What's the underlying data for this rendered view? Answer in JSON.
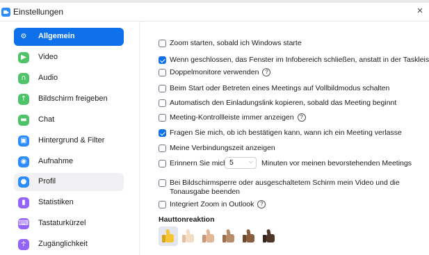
{
  "window": {
    "title": "Einstellungen",
    "close_glyph": "×"
  },
  "sidebar": {
    "items": [
      {
        "label": "Allgemein",
        "icon": "gear-icon",
        "color": "#0e71eb",
        "glyph": "⚙"
      },
      {
        "label": "Video",
        "icon": "video-camera-icon",
        "color": "#4fc36a",
        "glyph": "▶"
      },
      {
        "label": "Audio",
        "icon": "headphones-icon",
        "color": "#4fc36a",
        "glyph": "∩"
      },
      {
        "label": "Bildschirm freigeben",
        "icon": "share-screen-icon",
        "color": "#4fc36a",
        "glyph": "↑"
      },
      {
        "label": "Chat",
        "icon": "chat-bubble-icon",
        "color": "#4fc36a",
        "glyph": "▬"
      },
      {
        "label": "Hintergrund & Filter",
        "icon": "background-icon",
        "color": "#2d8cff",
        "glyph": "▣"
      },
      {
        "label": "Aufnahme",
        "icon": "record-icon",
        "color": "#2d8cff",
        "glyph": "◉"
      },
      {
        "label": "Profil",
        "icon": "profile-icon",
        "color": "#2d8cff",
        "glyph": "●"
      },
      {
        "label": "Statistiken",
        "icon": "statistics-icon",
        "color": "#9463f7",
        "glyph": "▮"
      },
      {
        "label": "Tastaturkürzel",
        "icon": "keyboard-icon",
        "color": "#9463f7",
        "glyph": "⌨"
      },
      {
        "label": "Zugänglichkeit",
        "icon": "accessibility-icon",
        "color": "#9463f7",
        "glyph": "☥"
      }
    ]
  },
  "general": {
    "options": [
      {
        "label": "Zoom starten, sobald ich Windows starte",
        "checked": false
      },
      {
        "label": "Wenn geschlossen, das Fenster im Infobereich schließen, anstatt in der Taskleiste",
        "checked": true
      },
      {
        "label": "Doppelmonitore verwenden",
        "checked": false
      },
      {
        "label": "Beim Start oder Betreten eines Meetings auf Vollbildmodus schalten",
        "checked": false
      },
      {
        "label": "Automatisch den Einladungslink kopieren, sobald das Meeting beginnt",
        "checked": false
      },
      {
        "label": "Meeting-Kontrollleiste immer anzeigen",
        "checked": false
      },
      {
        "label": "Fragen Sie mich, ob ich bestätigen kann, wann ich ein Meeting verlasse",
        "checked": true
      },
      {
        "label": "Meine Verbindungszeit anzeigen",
        "checked": false
      },
      {
        "label": "Erinnern Sie mich",
        "checked": false,
        "select_value": "5",
        "after": "Minuten vor meinen bevorstehenden Meetings"
      },
      {
        "label_line1": "Bei Bildschirmsperre oder ausgeschaltetem Schirm mein Video und die",
        "label_line2": "Tonausgabe beenden",
        "checked": false
      },
      {
        "label": "Integriert Zoom in Outlook",
        "checked": false
      }
    ],
    "help_glyph": "?",
    "skin_tone_heading": "Hauttonreaktion",
    "skin_tones": [
      {
        "name": "default",
        "color": "#f6c533",
        "cuff": "#d9a514",
        "selected": true
      },
      {
        "name": "light",
        "color": "#f5dcc5",
        "cuff": "#e2bfa2",
        "selected": false
      },
      {
        "name": "medium-light",
        "color": "#e2b796",
        "cuff": "#c99876",
        "selected": false
      },
      {
        "name": "medium",
        "color": "#b98b68",
        "cuff": "#9c6f4e",
        "selected": false
      },
      {
        "name": "medium-dark",
        "color": "#8a5d3f",
        "cuff": "#6e472d",
        "selected": false
      },
      {
        "name": "dark",
        "color": "#4d3528",
        "cuff": "#38261c",
        "selected": false
      }
    ]
  }
}
